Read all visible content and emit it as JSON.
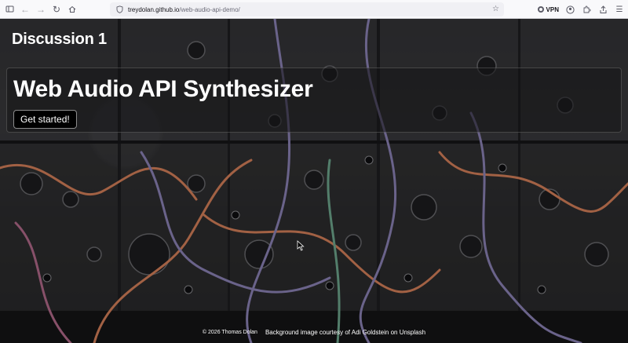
{
  "browser": {
    "url_host": "treydolan.github.io",
    "url_path": "/web-audio-api-demo/",
    "vpn_label": "VPN",
    "icons": [
      "sidebar-icon",
      "back-icon",
      "forward-icon",
      "reload-icon",
      "home-icon",
      "lock-icon",
      "star-icon",
      "account-icon",
      "extensions-icon",
      "share-icon",
      "menu-icon"
    ]
  },
  "page": {
    "site_title": "Discussion 1",
    "hero": {
      "heading": "Web Audio API Synthesizer",
      "button_label": "Get started!"
    },
    "footer": {
      "copyright": "© 2026 Thomas Dolan",
      "credit": "Background image courtesy of Adi Goldstein on Unsplash"
    }
  },
  "colors": {
    "overlay": "#141416",
    "button_bg": "#000000",
    "text": "#ffffff",
    "cable_orange": "#d9825b",
    "cable_purple": "#8e84b8"
  }
}
